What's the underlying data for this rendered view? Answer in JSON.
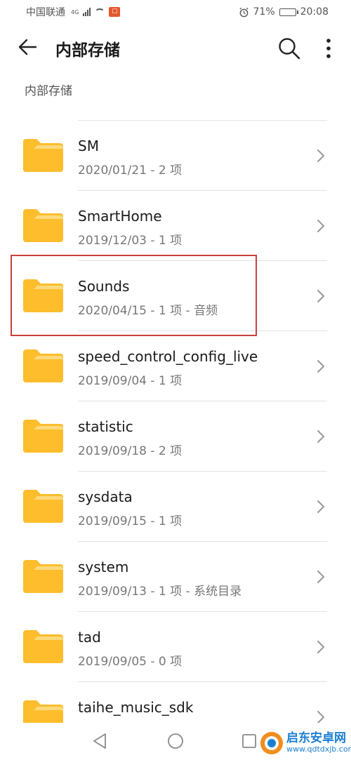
{
  "status_bar": {
    "carrier": "中国联通",
    "network": "4G",
    "battery": "71%",
    "battery_level": 0.71,
    "time": "20:08"
  },
  "header": {
    "title": "内部存储"
  },
  "breadcrumb": "内部存储",
  "folders": [
    {
      "name": "SM",
      "meta": "2020/01/21 - 2 项"
    },
    {
      "name": "SmartHome",
      "meta": "2019/12/03 - 1 项"
    },
    {
      "name": "Sounds",
      "meta": "2020/04/15 - 1 项 - 音频"
    },
    {
      "name": "speed_control_config_live",
      "meta": "2019/09/04 - 1 项"
    },
    {
      "name": "statistic",
      "meta": "2019/09/18 - 2 项"
    },
    {
      "name": "sysdata",
      "meta": "2019/09/15 - 1 项"
    },
    {
      "name": "system",
      "meta": "2019/09/13 - 1 项 - 系统目录"
    },
    {
      "name": "tad",
      "meta": "2019/09/05 - 0 项"
    },
    {
      "name": "taihe_music_sdk",
      "meta": ""
    }
  ],
  "watermark": {
    "name": "启东安卓网",
    "url": "www.qdtdxjb.com"
  },
  "colors": {
    "folder": "#FDBD2C",
    "folder_tab": "#FCD97A",
    "highlight": "#C8413B"
  }
}
